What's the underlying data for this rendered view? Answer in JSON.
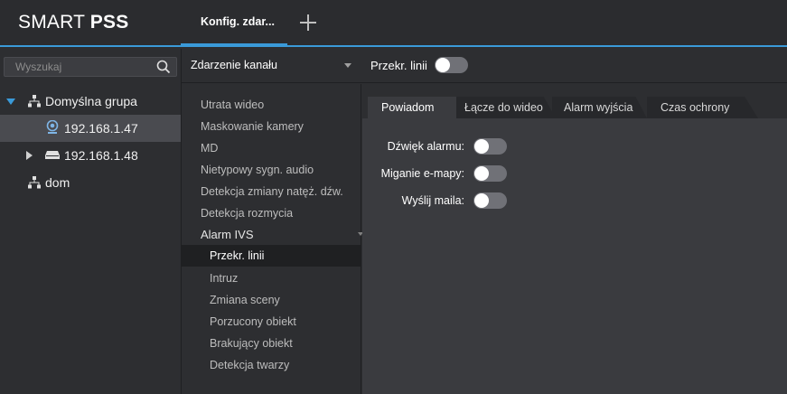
{
  "app": {
    "logo_light": "SMART ",
    "logo_bold": "PSS"
  },
  "tabs": {
    "active_label": "Konfig. zdar..."
  },
  "sidebar": {
    "search_placeholder": "Wyszukaj",
    "tree": [
      {
        "label": "Domyślna grupa",
        "type": "group",
        "expanded": true
      },
      {
        "label": "192.168.1.47",
        "type": "camera",
        "selected": true
      },
      {
        "label": "192.168.1.48",
        "type": "nvr",
        "expanded": false
      },
      {
        "label": "dom",
        "type": "group"
      }
    ]
  },
  "event_bar": {
    "event_type": "Zdarzenie kanału",
    "rule_name": "Przekr. linii",
    "rule_enabled": false
  },
  "events": {
    "items": [
      "Utrata wideo",
      "Maskowanie kamery",
      "MD",
      "Nietypowy sygn. audio",
      "Detekcja zmiany natęż. dźw.",
      "Detekcja rozmycia"
    ],
    "group_label": "Alarm IVS",
    "sub_items": [
      "Przekr. linii",
      "Intruz",
      "Zmiana sceny",
      "Porzucony obiekt",
      "Brakujący obiekt",
      "Detekcja twarzy"
    ],
    "selected_sub_index": 0
  },
  "config": {
    "tabs": [
      "Powiadom",
      "Łącze do wideo",
      "Alarm wyjścia",
      "Czas ochrony"
    ],
    "active_tab_index": 0,
    "options": [
      {
        "label": "Dźwięk alarmu:",
        "enabled": false
      },
      {
        "label": "Miganie e-mapy:",
        "enabled": false
      },
      {
        "label": "Wyślij maila:",
        "enabled": false
      }
    ]
  },
  "colors": {
    "accent": "#3a9ad9",
    "toggle_off": "#707177",
    "background": "#2d2e31"
  }
}
